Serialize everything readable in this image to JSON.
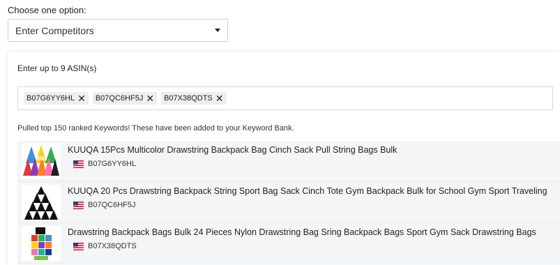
{
  "choose_label": "Choose one option:",
  "select": {
    "value": "Enter Competitors"
  },
  "asin_label": "Enter up to 9 ASIN(s)",
  "chips": [
    {
      "label": "B07G6YY6HL"
    },
    {
      "label": "B07QC6HF5J"
    },
    {
      "label": "B07X38QDTS"
    }
  ],
  "status_text": "Pulled top 150 ranked Keywords! These have been added to your Keyword Bank.",
  "results": [
    {
      "title": "KUUQA 15Pcs Multicolor Drawstring Backpack Bag Cinch Sack Pull String Bags Bulk",
      "asin": "B07G6YY6HL",
      "marketplace_icon": "us-flag-icon"
    },
    {
      "title": "KUUQA 20 Pcs Drawstring Backpack String Sport Bag Sack Cinch Tote Gym Backpack Bulk for School Gym Sport Traveling",
      "asin": "B07QC6HF5J",
      "marketplace_icon": "us-flag-icon"
    },
    {
      "title": "Drawstring Backpack Bags Bulk 24 Pieces Nylon Drawstring Bag Sring Backpack Bags Sport Gym Sack Drawstring Bags",
      "asin": "B07X38QDTS",
      "marketplace_icon": "us-flag-icon"
    }
  ]
}
